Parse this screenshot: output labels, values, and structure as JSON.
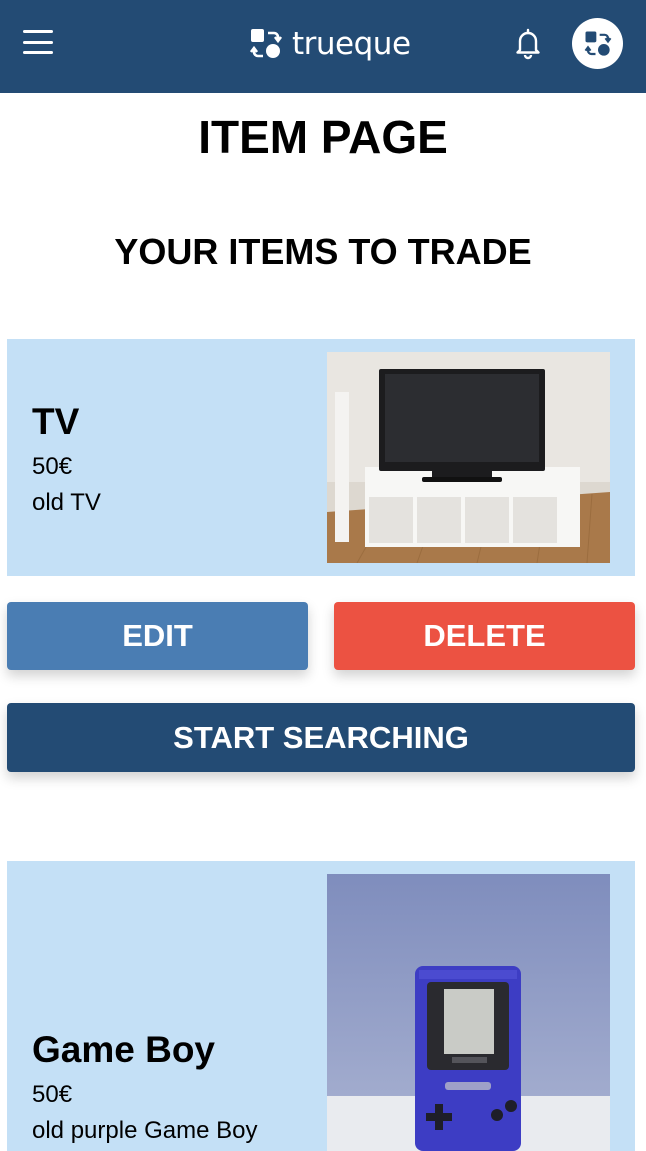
{
  "header": {
    "brand": "trueque",
    "menu_icon": "hamburger-menu-icon",
    "notification_icon": "bell-icon",
    "avatar_icon": "user-avatar-icon",
    "color": "#234b74"
  },
  "page": {
    "title": "ITEM PAGE",
    "section_title": "YOUR ITEMS TO TRADE"
  },
  "items": [
    {
      "name": "TV",
      "price": "50€",
      "description": "old TV",
      "edit_label": "EDIT",
      "delete_label": "DELETE",
      "search_label": "START SEARCHING"
    },
    {
      "name": "Game Boy",
      "price": "50€",
      "description": "old purple Game Boy"
    }
  ],
  "colors": {
    "card_bg": "#c4e0f6",
    "edit": "#4a7db3",
    "delete": "#ec5242",
    "search": "#234b74"
  }
}
